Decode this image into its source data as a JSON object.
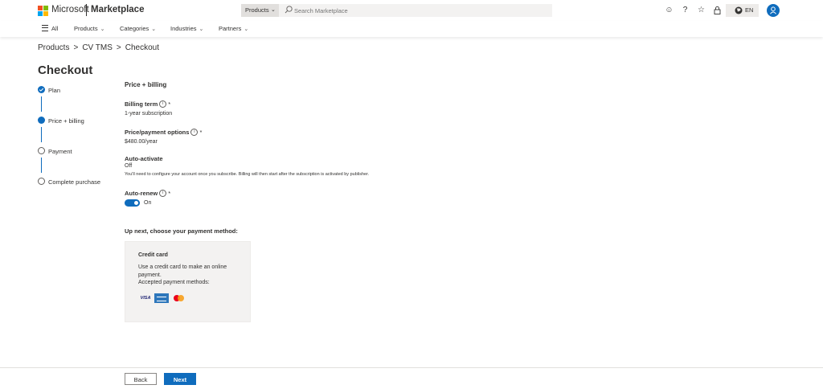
{
  "header": {
    "brand": "Microsoft",
    "product": "Marketplace",
    "search": {
      "scope": "Products",
      "placeholder": "Search Marketplace"
    },
    "icons": [
      "smiley-icon",
      "help-icon",
      "favorites-star-icon",
      "lock-icon"
    ],
    "language": "EN"
  },
  "nav": {
    "all": "All",
    "items": [
      {
        "label": "Products"
      },
      {
        "label": "Categories"
      },
      {
        "label": "Industries"
      },
      {
        "label": "Partners"
      }
    ]
  },
  "breadcrumb": [
    "Products",
    "CV TMS",
    "Checkout"
  ],
  "page": {
    "title": "Checkout"
  },
  "steps": [
    {
      "label": "Plan",
      "state": "completed"
    },
    {
      "label": "Price + billing",
      "state": "current"
    },
    {
      "label": "Payment",
      "state": "pending"
    },
    {
      "label": "Complete purchase",
      "state": "pending"
    }
  ],
  "main": {
    "section_title": "Price + billing",
    "billing_term": {
      "label": "Billing term",
      "required": "*",
      "value": "1-year subscription"
    },
    "price_options": {
      "label": "Price/payment options",
      "required": "*",
      "value": "$480.00/year"
    },
    "auto_activate": {
      "label": "Auto-activate",
      "value": "Off",
      "note": "You'll need to configure your account once you subscribe. Billing will then start after the subscription is activated by publisher."
    },
    "auto_renew": {
      "label": "Auto-renew",
      "required": "*",
      "toggle_label": "On",
      "enabled": true
    },
    "up_next": "Up next, choose your payment method:",
    "payment_card": {
      "title": "Credit card",
      "description": "Use a credit card to make an online payment.",
      "accepted": "Accepted payment methods:",
      "visa_text": "VISA",
      "methods": [
        "visa-logo",
        "amex-logo",
        "mastercard-logo"
      ]
    }
  },
  "footer": {
    "back_label": "Back",
    "next_label": "Next"
  },
  "colors": {
    "accent": "#0f6cbd",
    "text": "#323130",
    "card_bg": "#f3f2f1"
  }
}
